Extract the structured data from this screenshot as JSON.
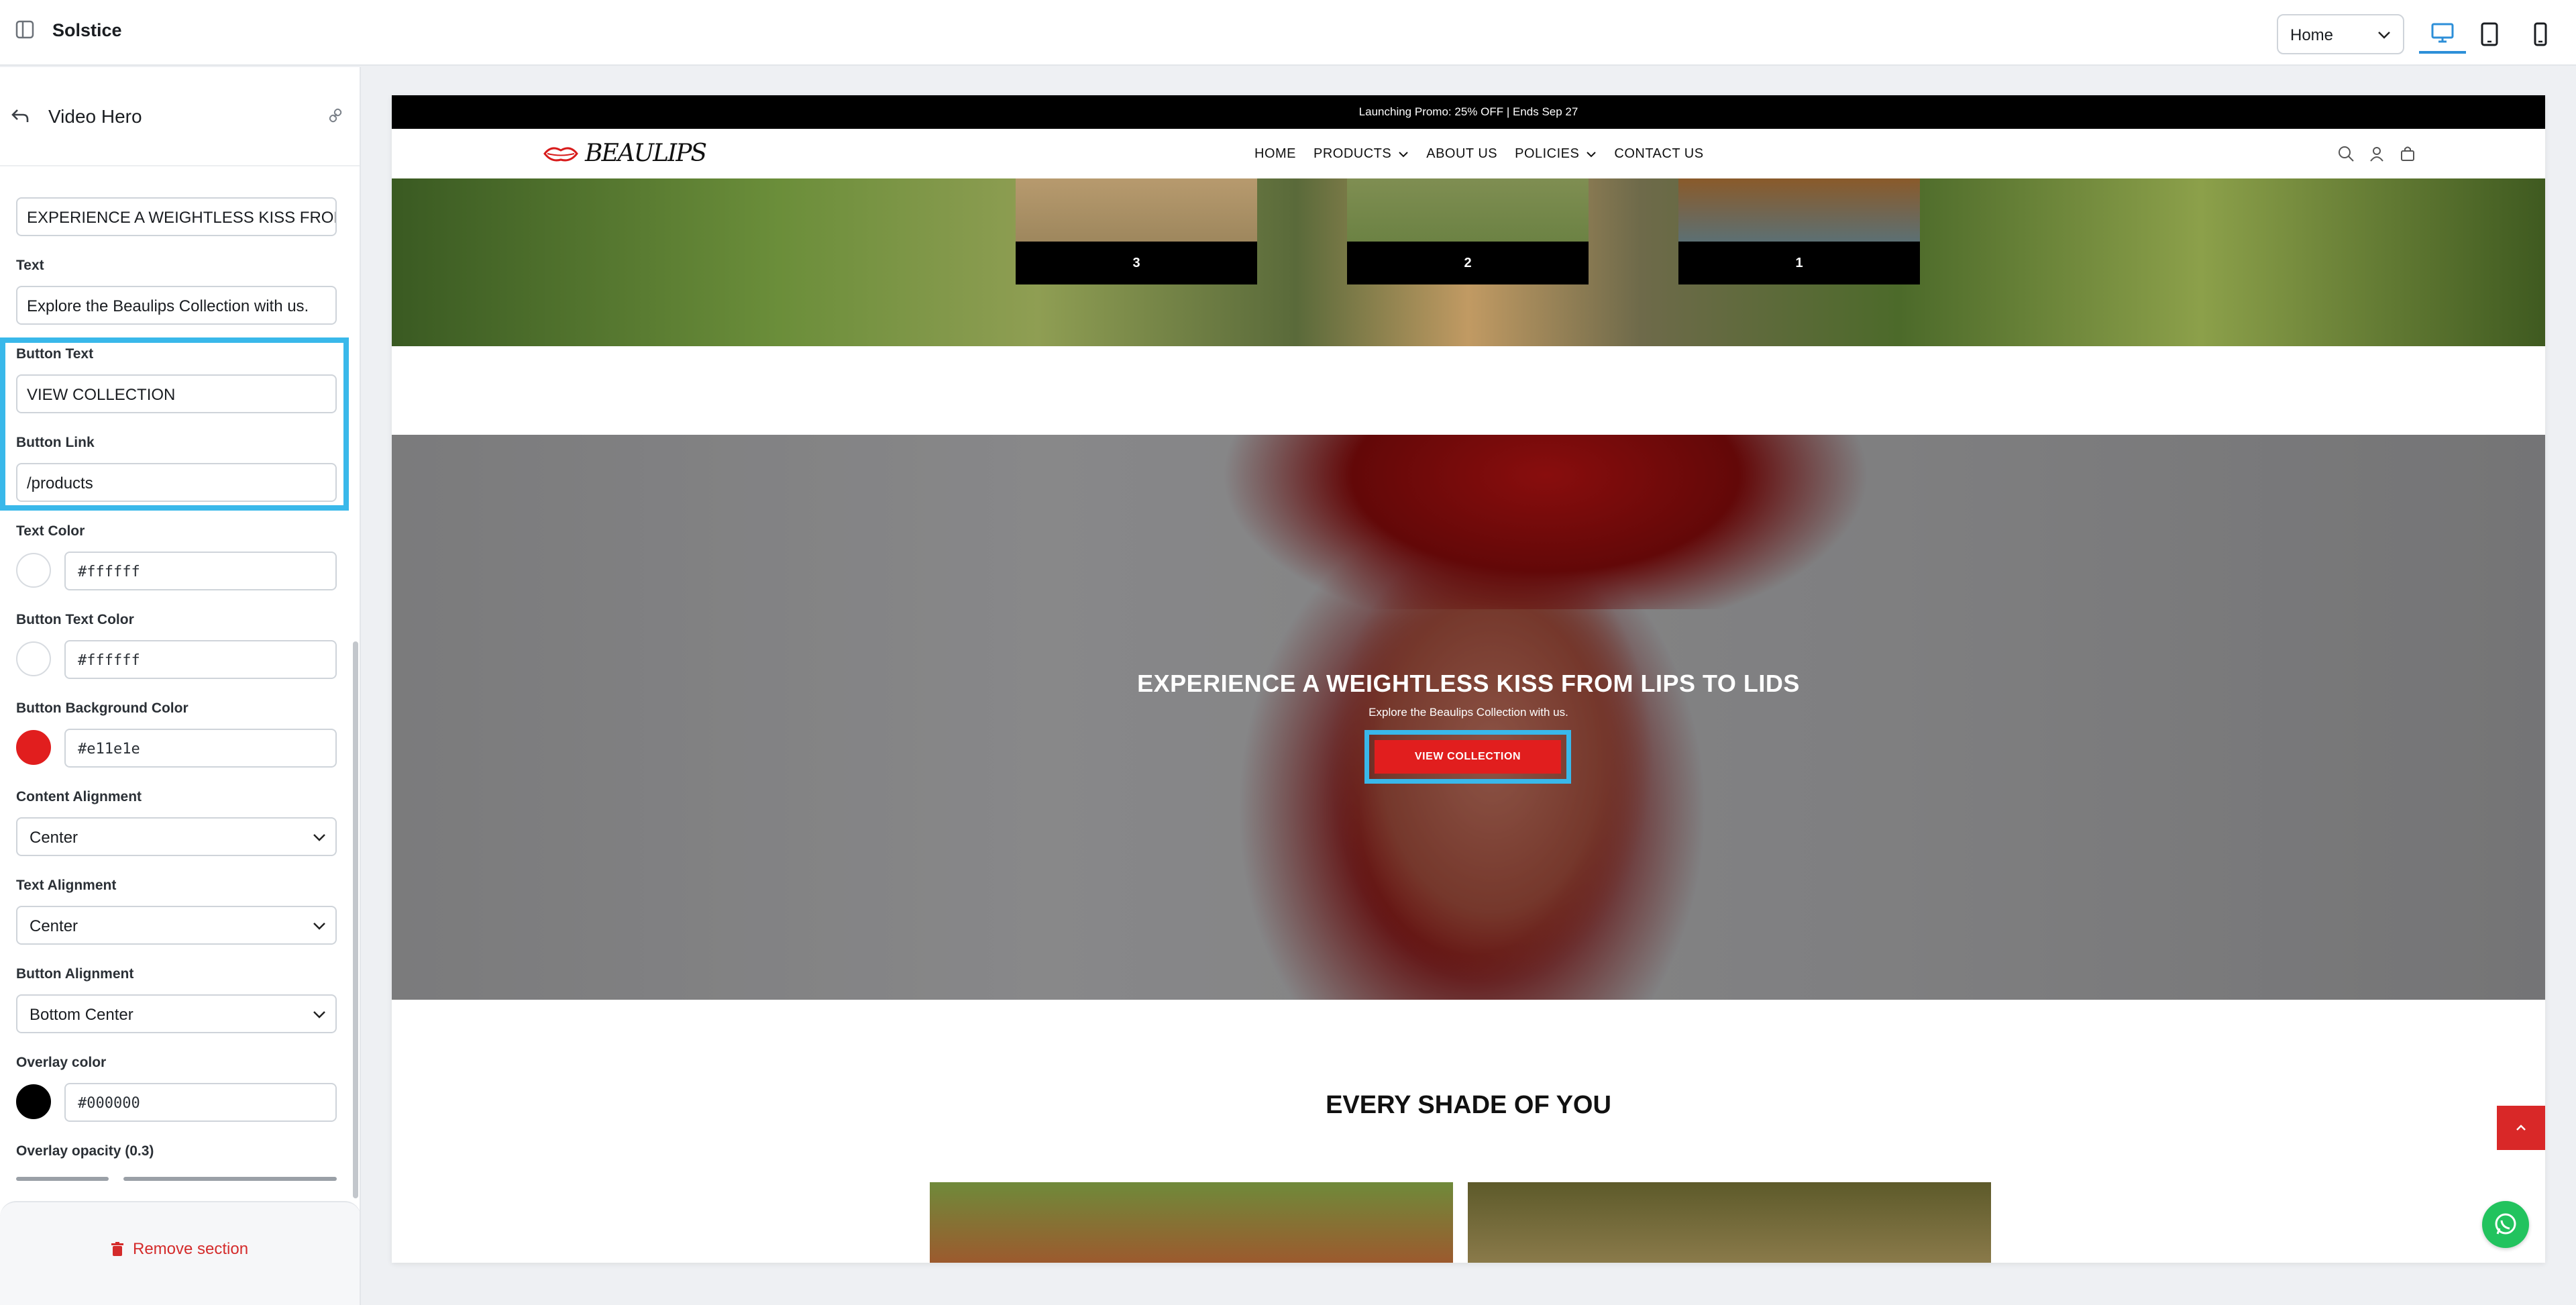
{
  "topbar": {
    "app_title": "Solstice",
    "page_select_value": "Home",
    "devices": [
      "desktop",
      "tablet",
      "mobile"
    ],
    "active_device": "desktop"
  },
  "panel": {
    "section_title": "Video Hero",
    "fields": {
      "heading_value": "EXPERIENCE A WEIGHTLESS KISS FROM",
      "text_label": "Text",
      "text_value": "Explore the Beaulips Collection with us.",
      "button_text_label": "Button Text",
      "button_text_value": "VIEW COLLECTION",
      "button_link_label": "Button Link",
      "button_link_value": "/products",
      "text_color_label": "Text Color",
      "text_color_value": "#ffffff",
      "button_text_color_label": "Button Text Color",
      "button_text_color_value": "#ffffff",
      "button_bg_label": "Button Background Color",
      "button_bg_value": "#e11e1e",
      "content_alignment_label": "Content Alignment",
      "content_alignment_value": "Center",
      "text_alignment_label": "Text Alignment",
      "text_alignment_value": "Center",
      "button_alignment_label": "Button Alignment",
      "button_alignment_value": "Bottom Center",
      "overlay_color_label": "Overlay color",
      "overlay_color_value": "#000000",
      "overlay_opacity_label": "Overlay opacity (0.3)"
    },
    "overlay_opacity": 0.3,
    "remove_label": "Remove section"
  },
  "site": {
    "promo": "Launching Promo: 25% OFF | Ends Sep 27",
    "logo_text": "BEAULIPS",
    "nav": [
      "HOME",
      "PRODUCTS",
      "ABOUT US",
      "POLICIES",
      "CONTACT US"
    ],
    "gallery_captions": [
      "3",
      "2",
      "1"
    ],
    "hero": {
      "title": "EXPERIENCE A WEIGHTLESS KISS FROM LIPS TO LIDS",
      "text": "Explore the Beaulips Collection with us.",
      "button": "VIEW COLLECTION"
    },
    "shade_title": "EVERY SHADE OF YOU"
  },
  "colors": {
    "accent_blue": "#39b8ea",
    "button_red": "#e11e1e",
    "remove_red": "#d42b2b",
    "whatsapp_green": "#22c35e"
  }
}
